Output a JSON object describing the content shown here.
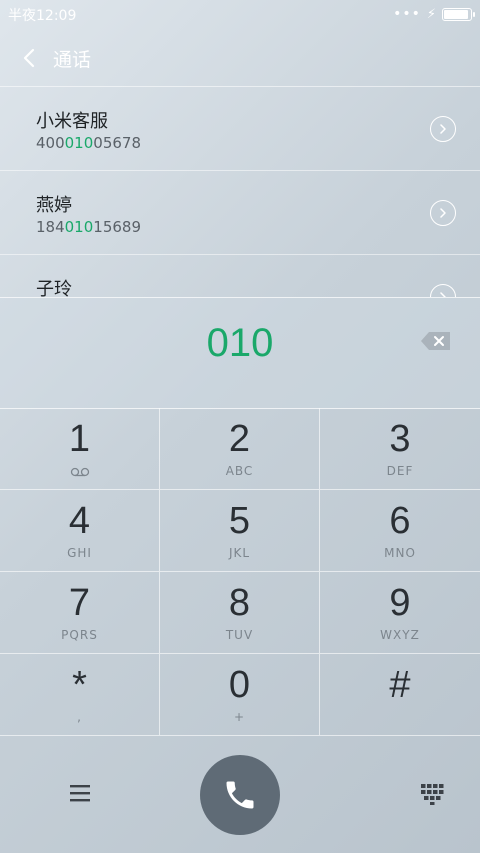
{
  "status": {
    "time": "半夜12:09",
    "battery_level": 0.95
  },
  "header": {
    "title": "通话"
  },
  "results": [
    {
      "name": "小米客服",
      "num_pre": "400",
      "num_match": "010",
      "num_post": "05678"
    },
    {
      "name": "燕婷",
      "num_pre": "184",
      "num_match": "010",
      "num_post": "15689"
    },
    {
      "name": "子玲",
      "num_pre": "",
      "num_match": "",
      "num_post": ""
    }
  ],
  "input": {
    "digits": "010"
  },
  "keypad": [
    {
      "digit": "1",
      "letters": ""
    },
    {
      "digit": "2",
      "letters": "ABC"
    },
    {
      "digit": "3",
      "letters": "DEF"
    },
    {
      "digit": "4",
      "letters": "GHI"
    },
    {
      "digit": "5",
      "letters": "JKL"
    },
    {
      "digit": "6",
      "letters": "MNO"
    },
    {
      "digit": "7",
      "letters": "PQRS"
    },
    {
      "digit": "8",
      "letters": "TUV"
    },
    {
      "digit": "9",
      "letters": "WXYZ"
    },
    {
      "digit": "*",
      "letters": ","
    },
    {
      "digit": "0",
      "letters": "+"
    },
    {
      "digit": "#",
      "letters": ""
    }
  ],
  "icons": {
    "back": "chevron-left-icon",
    "detail": "chevron-right-circle-icon",
    "delete": "backspace-icon",
    "voicemail": "voicemail-icon",
    "menu": "menu-icon",
    "call": "phone-icon",
    "dialpad": "dialpad-icon"
  },
  "colors": {
    "accent": "#1aa86a",
    "call_button": "#5f6b76"
  }
}
